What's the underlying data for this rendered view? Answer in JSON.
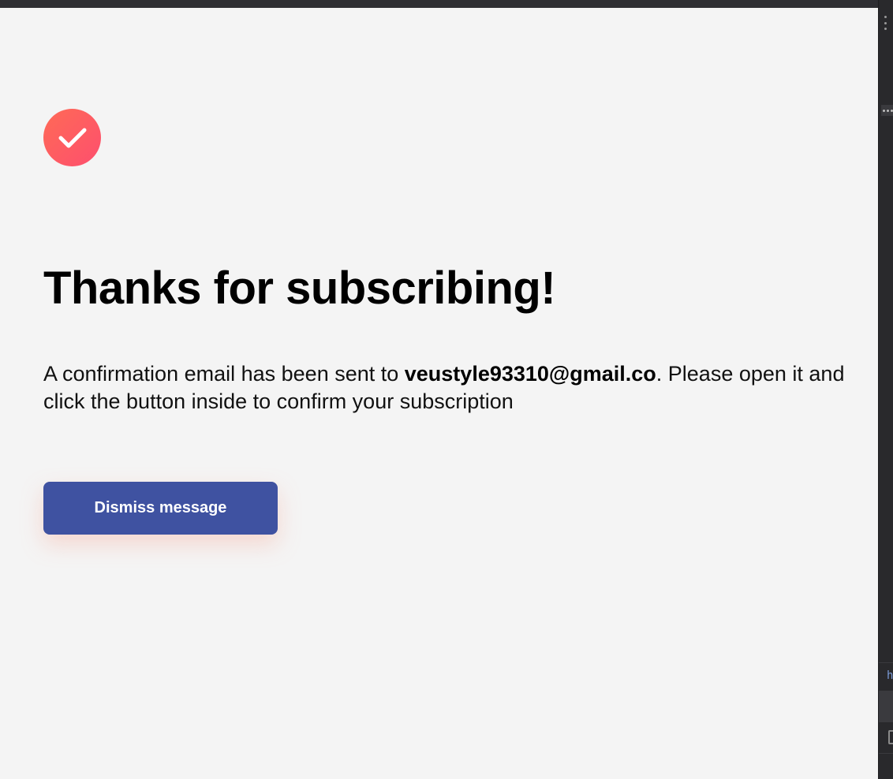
{
  "success": {
    "icon": "check-icon",
    "accent_gradient": [
      "#ff6a56",
      "#fd4f6e"
    ]
  },
  "heading": "Thanks for subscribing!",
  "message": {
    "before": "A confirmation email has been sent to ",
    "email": "veustyle93310@gmail.co",
    "after": ". Please open it and click the button inside to confirm your subscription"
  },
  "dismiss_button": {
    "label": "Dismiss message",
    "color": "#3f52a1"
  },
  "devtools_strip": {
    "letter": "h"
  }
}
